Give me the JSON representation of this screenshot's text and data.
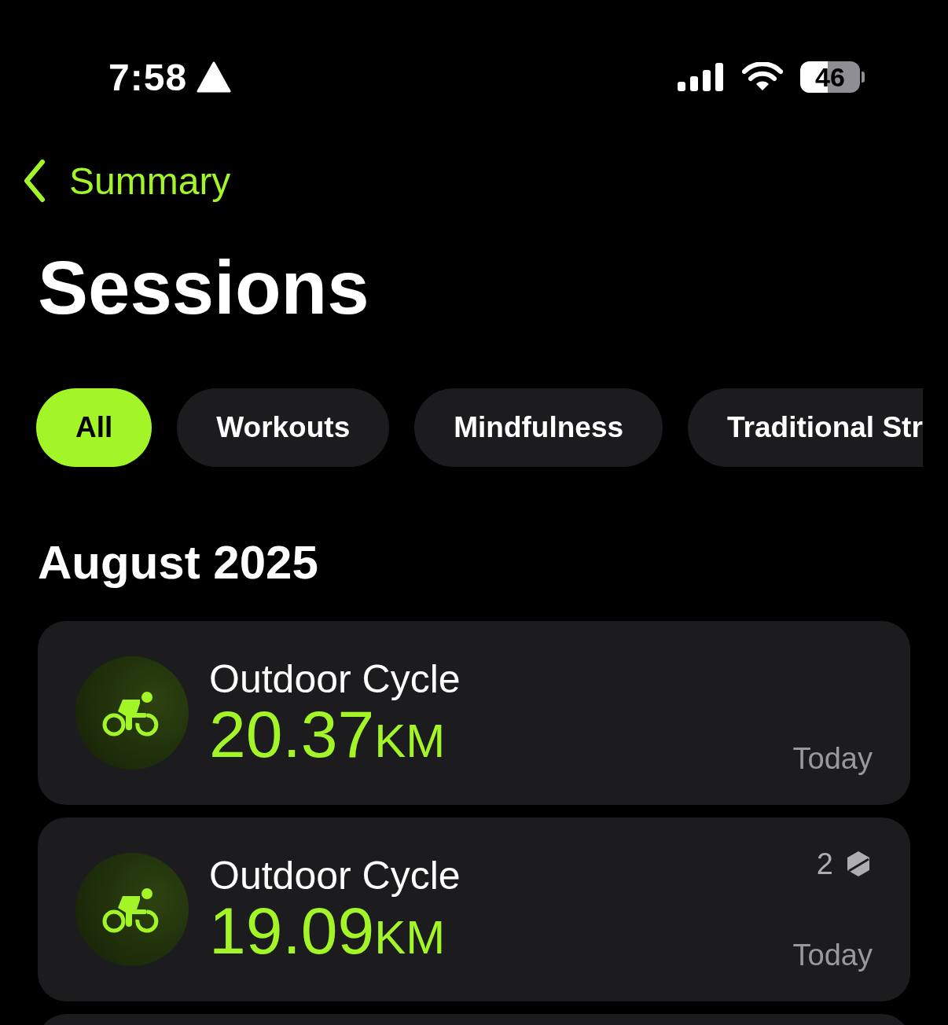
{
  "status_bar": {
    "time": "7:58",
    "battery": "46"
  },
  "nav": {
    "back_label": "Summary"
  },
  "title": "Sessions",
  "filters": [
    {
      "label": "All",
      "selected": true
    },
    {
      "label": "Workouts",
      "selected": false
    },
    {
      "label": "Mindfulness",
      "selected": false
    },
    {
      "label": "Traditional Str",
      "selected": false
    }
  ],
  "sections": [
    {
      "heading": "August 2025",
      "sessions": [
        {
          "kind": "cycle",
          "name": "Outdoor Cycle",
          "value": "20.37",
          "unit": "KM",
          "date": "Today"
        },
        {
          "kind": "cycle",
          "name": "Outdoor Cycle",
          "value": "19.09",
          "unit": "KM",
          "date": "Today",
          "count": "2"
        }
      ]
    }
  ]
}
